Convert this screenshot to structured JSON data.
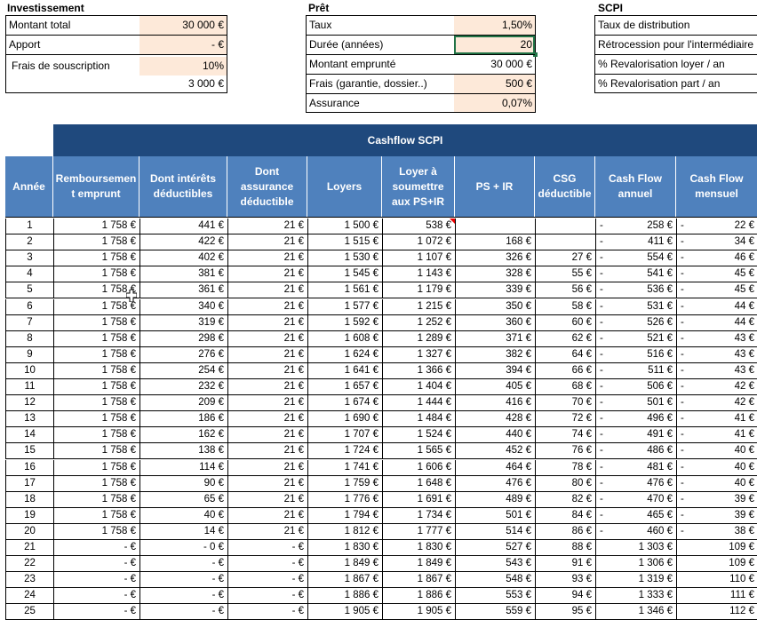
{
  "investissement": {
    "title": "Investissement",
    "rows": [
      {
        "label": "Montant total",
        "value": "30 000 €"
      },
      {
        "label": "Apport",
        "value": "-   €"
      },
      {
        "label": "Frais de souscription",
        "value": "10%"
      }
    ],
    "frais_amount": "3 000 €"
  },
  "pret": {
    "title": "Prêt",
    "rows": [
      {
        "label": "Taux",
        "value": "1,50%"
      },
      {
        "label": "Durée (années)",
        "value": "20"
      },
      {
        "label": "Montant emprunté",
        "value": "30 000 €"
      },
      {
        "label": "Frais (garantie, dossier..)",
        "value": "500 €"
      },
      {
        "label": "Assurance",
        "value": "0,07%"
      }
    ]
  },
  "scpi": {
    "title": "SCPI",
    "rows": [
      {
        "label": "Taux de distribution"
      },
      {
        "label": "Rétrocession pour l'intermédiaire"
      },
      {
        "label": "% Revalorisation loyer / an"
      },
      {
        "label": "% Revalorisation part / an"
      }
    ]
  },
  "table": {
    "banner": "Cashflow SCPI",
    "headers": [
      "Année",
      "Remboursemen t emprunt",
      "Dont intérêts déductibles",
      "Dont assurance déductible",
      "Loyers",
      "Loyer à soumettre aux PS+IR",
      "PS + IR",
      "CSG déductible",
      "Cash Flow annuel",
      "Cash Flow mensuel"
    ],
    "rows": [
      [
        "1",
        "1 758 €",
        "441 €",
        "21 €",
        "1 500 €",
        "538 €",
        "",
        "",
        "-",
        "258 €",
        "-",
        "22 €"
      ],
      [
        "2",
        "1 758 €",
        "422 €",
        "21 €",
        "1 515 €",
        "1 072 €",
        "168 €",
        "",
        "-",
        "411 €",
        "-",
        "34 €"
      ],
      [
        "3",
        "1 758 €",
        "402 €",
        "21 €",
        "1 530 €",
        "1 107 €",
        "326 €",
        "27 €",
        "-",
        "554 €",
        "-",
        "46 €"
      ],
      [
        "4",
        "1 758 €",
        "381 €",
        "21 €",
        "1 545 €",
        "1 143 €",
        "328 €",
        "55 €",
        "-",
        "541 €",
        "-",
        "45 €"
      ],
      [
        "5",
        "1 758 €",
        "361 €",
        "21 €",
        "1 561 €",
        "1 179 €",
        "339 €",
        "56 €",
        "-",
        "536 €",
        "-",
        "45 €"
      ],
      [
        "6",
        "1 758 €",
        "340 €",
        "21 €",
        "1 577 €",
        "1 215 €",
        "350 €",
        "58 €",
        "-",
        "531 €",
        "-",
        "44 €"
      ],
      [
        "7",
        "1 758 €",
        "319 €",
        "21 €",
        "1 592 €",
        "1 252 €",
        "360 €",
        "60 €",
        "-",
        "526 €",
        "-",
        "44 €"
      ],
      [
        "8",
        "1 758 €",
        "298 €",
        "21 €",
        "1 608 €",
        "1 289 €",
        "371 €",
        "62 €",
        "-",
        "521 €",
        "-",
        "43 €"
      ],
      [
        "9",
        "1 758 €",
        "276 €",
        "21 €",
        "1 624 €",
        "1 327 €",
        "382 €",
        "64 €",
        "-",
        "516 €",
        "-",
        "43 €"
      ],
      [
        "10",
        "1 758 €",
        "254 €",
        "21 €",
        "1 641 €",
        "1 366 €",
        "394 €",
        "66 €",
        "-",
        "511 €",
        "-",
        "43 €"
      ],
      [
        "11",
        "1 758 €",
        "232 €",
        "21 €",
        "1 657 €",
        "1 404 €",
        "405 €",
        "68 €",
        "-",
        "506 €",
        "-",
        "42 €"
      ],
      [
        "12",
        "1 758 €",
        "209 €",
        "21 €",
        "1 674 €",
        "1 444 €",
        "416 €",
        "70 €",
        "-",
        "501 €",
        "-",
        "42 €"
      ],
      [
        "13",
        "1 758 €",
        "186 €",
        "21 €",
        "1 690 €",
        "1 484 €",
        "428 €",
        "72 €",
        "-",
        "496 €",
        "-",
        "41 €"
      ],
      [
        "14",
        "1 758 €",
        "162 €",
        "21 €",
        "1 707 €",
        "1 524 €",
        "440 €",
        "74 €",
        "-",
        "491 €",
        "-",
        "41 €"
      ],
      [
        "15",
        "1 758 €",
        "138 €",
        "21 €",
        "1 724 €",
        "1 565 €",
        "452 €",
        "76 €",
        "-",
        "486 €",
        "-",
        "40 €"
      ],
      [
        "16",
        "1 758 €",
        "114 €",
        "21 €",
        "1 741 €",
        "1 606 €",
        "464 €",
        "78 €",
        "-",
        "481 €",
        "-",
        "40 €"
      ],
      [
        "17",
        "1 758 €",
        "90 €",
        "21 €",
        "1 759 €",
        "1 648 €",
        "476 €",
        "80 €",
        "-",
        "476 €",
        "-",
        "40 €"
      ],
      [
        "18",
        "1 758 €",
        "65 €",
        "21 €",
        "1 776 €",
        "1 691 €",
        "489 €",
        "82 €",
        "-",
        "470 €",
        "-",
        "39 €"
      ],
      [
        "19",
        "1 758 €",
        "40 €",
        "21 €",
        "1 794 €",
        "1 734 €",
        "501 €",
        "84 €",
        "-",
        "465 €",
        "-",
        "39 €"
      ],
      [
        "20",
        "1 758 €",
        "14 €",
        "21 €",
        "1 812 €",
        "1 777 €",
        "514 €",
        "86 €",
        "-",
        "460 €",
        "-",
        "38 €"
      ],
      [
        "21",
        "-   €",
        "-   0 €",
        "-   €",
        "1 830 €",
        "1 830 €",
        "527 €",
        "88 €",
        "",
        "1 303 €",
        "",
        "109 €"
      ],
      [
        "22",
        "-   €",
        "-   €",
        "-   €",
        "1 849 €",
        "1 849 €",
        "543 €",
        "91 €",
        "",
        "1 306 €",
        "",
        "109 €"
      ],
      [
        "23",
        "-   €",
        "-   €",
        "-   €",
        "1 867 €",
        "1 867 €",
        "548 €",
        "93 €",
        "",
        "1 319 €",
        "",
        "110 €"
      ],
      [
        "24",
        "-   €",
        "-   €",
        "-   €",
        "1 886 €",
        "1 886 €",
        "553 €",
        "94 €",
        "",
        "1 333 €",
        "",
        "111 €"
      ],
      [
        "25",
        "-   €",
        "-   €",
        "-   €",
        "1 905 €",
        "1 905 €",
        "559 €",
        "95 €",
        "",
        "1 346 €",
        "",
        "112 €"
      ]
    ]
  },
  "colors": {
    "peach": "#fde9d9",
    "header_dark": "#1f497d",
    "header_blue": "#4f81bd",
    "selection_green": "#217346",
    "comment_red": "#e00000"
  }
}
